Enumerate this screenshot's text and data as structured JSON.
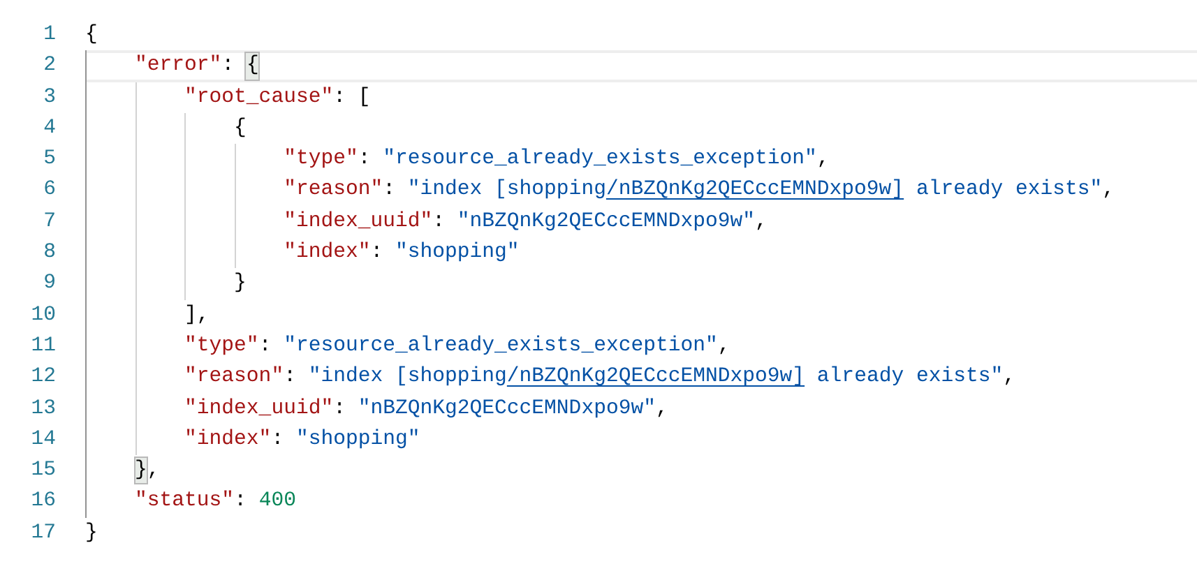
{
  "editor": {
    "lines": [
      {
        "number": "1",
        "current": false,
        "tokens": [
          {
            "kind": "punct",
            "text": "{",
            "matched": false
          }
        ],
        "children": [
          {
            "number": "2",
            "current": true,
            "tokens": [
              {
                "kind": "key",
                "text": "\"error\"",
                "matched": false
              },
              {
                "kind": "punct",
                "text": ": ",
                "matched": false
              },
              {
                "kind": "punct",
                "text": "{",
                "matched": true
              }
            ],
            "children": [
              {
                "number": "3",
                "current": false,
                "tokens": [
                  {
                    "kind": "key",
                    "text": "\"root_cause\"",
                    "matched": false
                  },
                  {
                    "kind": "punct",
                    "text": ": [",
                    "matched": false
                  }
                ],
                "children": [
                  {
                    "number": "4",
                    "current": false,
                    "tokens": [
                      {
                        "kind": "punct",
                        "text": "{",
                        "matched": false
                      }
                    ],
                    "children": [
                      {
                        "number": "5",
                        "current": false,
                        "tokens": [
                          {
                            "kind": "key",
                            "text": "\"type\"",
                            "matched": false
                          },
                          {
                            "kind": "punct",
                            "text": ": ",
                            "matched": false
                          },
                          {
                            "kind": "string",
                            "text": "\"resource_already_exists_exception\"",
                            "matched": false
                          },
                          {
                            "kind": "punct",
                            "text": ",",
                            "matched": false
                          }
                        ]
                      },
                      {
                        "number": "6",
                        "current": false,
                        "tokens": [
                          {
                            "kind": "key",
                            "text": "\"reason\"",
                            "matched": false
                          },
                          {
                            "kind": "punct",
                            "text": ": ",
                            "matched": false
                          },
                          {
                            "kind": "string",
                            "text": "\"index [shopping",
                            "matched": false
                          },
                          {
                            "kind": "link",
                            "text": "/nBZQnKg2QECccEMNDxpo9w]",
                            "matched": false
                          },
                          {
                            "kind": "string",
                            "text": " already exists\"",
                            "matched": false
                          },
                          {
                            "kind": "punct",
                            "text": ",",
                            "matched": false
                          }
                        ]
                      },
                      {
                        "number": "7",
                        "current": false,
                        "tokens": [
                          {
                            "kind": "key",
                            "text": "\"index_uuid\"",
                            "matched": false
                          },
                          {
                            "kind": "punct",
                            "text": ": ",
                            "matched": false
                          },
                          {
                            "kind": "string",
                            "text": "\"nBZQnKg2QECccEMNDxpo9w\"",
                            "matched": false
                          },
                          {
                            "kind": "punct",
                            "text": ",",
                            "matched": false
                          }
                        ]
                      },
                      {
                        "number": "8",
                        "current": false,
                        "tokens": [
                          {
                            "kind": "key",
                            "text": "\"index\"",
                            "matched": false
                          },
                          {
                            "kind": "punct",
                            "text": ": ",
                            "matched": false
                          },
                          {
                            "kind": "string",
                            "text": "\"shopping\"",
                            "matched": false
                          }
                        ]
                      }
                    ]
                  },
                  {
                    "number": "9",
                    "current": false,
                    "tokens": [
                      {
                        "kind": "punct",
                        "text": "}",
                        "matched": false
                      }
                    ]
                  }
                ]
              },
              {
                "number": "10",
                "current": false,
                "tokens": [
                  {
                    "kind": "punct",
                    "text": "],",
                    "matched": false
                  }
                ]
              },
              {
                "number": "11",
                "current": false,
                "tokens": [
                  {
                    "kind": "key",
                    "text": "\"type\"",
                    "matched": false
                  },
                  {
                    "kind": "punct",
                    "text": ": ",
                    "matched": false
                  },
                  {
                    "kind": "string",
                    "text": "\"resource_already_exists_exception\"",
                    "matched": false
                  },
                  {
                    "kind": "punct",
                    "text": ",",
                    "matched": false
                  }
                ]
              },
              {
                "number": "12",
                "current": false,
                "tokens": [
                  {
                    "kind": "key",
                    "text": "\"reason\"",
                    "matched": false
                  },
                  {
                    "kind": "punct",
                    "text": ": ",
                    "matched": false
                  },
                  {
                    "kind": "string",
                    "text": "\"index [shopping",
                    "matched": false
                  },
                  {
                    "kind": "link",
                    "text": "/nBZQnKg2QECccEMNDxpo9w]",
                    "matched": false
                  },
                  {
                    "kind": "string",
                    "text": " already exists\"",
                    "matched": false
                  },
                  {
                    "kind": "punct",
                    "text": ",",
                    "matched": false
                  }
                ]
              },
              {
                "number": "13",
                "current": false,
                "tokens": [
                  {
                    "kind": "key",
                    "text": "\"index_uuid\"",
                    "matched": false
                  },
                  {
                    "kind": "punct",
                    "text": ": ",
                    "matched": false
                  },
                  {
                    "kind": "string",
                    "text": "\"nBZQnKg2QECccEMNDxpo9w\"",
                    "matched": false
                  },
                  {
                    "kind": "punct",
                    "text": ",",
                    "matched": false
                  }
                ]
              },
              {
                "number": "14",
                "current": false,
                "tokens": [
                  {
                    "kind": "key",
                    "text": "\"index\"",
                    "matched": false
                  },
                  {
                    "kind": "punct",
                    "text": ": ",
                    "matched": false
                  },
                  {
                    "kind": "string",
                    "text": "\"shopping\"",
                    "matched": false
                  }
                ]
              }
            ]
          },
          {
            "number": "15",
            "current": false,
            "tokens": [
              {
                "kind": "punct",
                "text": "}",
                "matched": true
              },
              {
                "kind": "punct",
                "text": ",",
                "matched": false
              }
            ]
          },
          {
            "number": "16",
            "current": false,
            "tokens": [
              {
                "kind": "key",
                "text": "\"status\"",
                "matched": false
              },
              {
                "kind": "punct",
                "text": ": ",
                "matched": false
              },
              {
                "kind": "number",
                "text": "400",
                "matched": false
              }
            ]
          }
        ]
      },
      {
        "number": "17",
        "current": false,
        "tokens": [
          {
            "kind": "punct",
            "text": "}",
            "matched": false
          }
        ]
      }
    ]
  }
}
